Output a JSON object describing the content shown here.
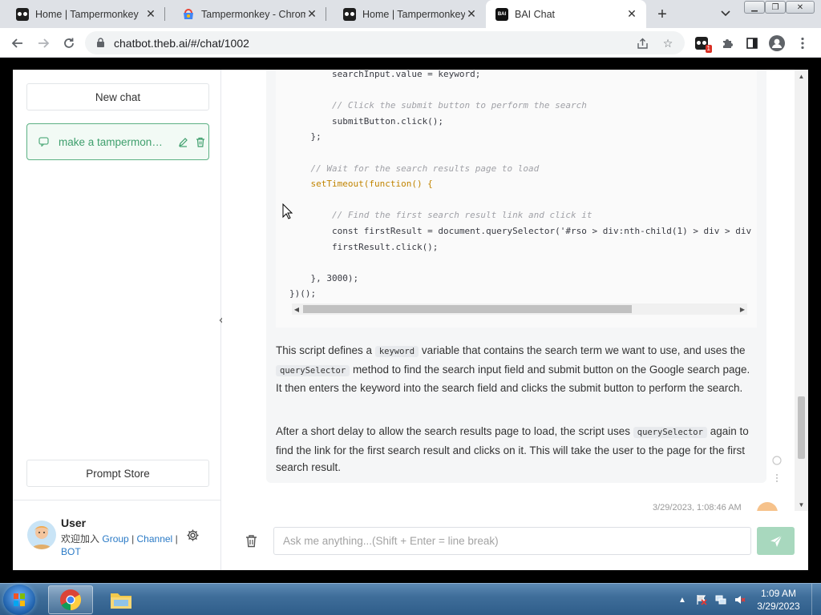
{
  "browser": {
    "tabs": [
      {
        "label": "Home | Tampermonkey",
        "icon": "tampermonkey-icon"
      },
      {
        "label": "Tampermonkey - Chrome",
        "icon": "chrome-webstore-icon"
      },
      {
        "label": "Home | Tampermonkey",
        "icon": "tampermonkey-icon"
      },
      {
        "label": "BAI Chat",
        "icon": "bai-icon",
        "active": true
      }
    ],
    "url": "chatbot.theb.ai/#/chat/1002",
    "extension_badge": "1"
  },
  "sidebar": {
    "new_chat_label": "New chat",
    "chats": [
      {
        "label": "make a tampermonkey script",
        "active": true
      }
    ],
    "prompt_store_label": "Prompt Store",
    "user": {
      "name": "User",
      "sub_prefix": "欢迎加入",
      "links": [
        "Group",
        "Channel",
        "BOT"
      ]
    }
  },
  "chat": {
    "code_lines": [
      "        searchInput.value = keyword;",
      "",
      "        // Click the submit button to perform the search",
      "        submitButton.click();",
      "    };",
      "",
      "    // Wait for the search results page to load",
      "    setTimeout(function() {",
      "",
      "        // Find the first search result link and click it",
      "        const firstResult = document.querySelector('#rso > div:nth-child(1) > div > div",
      "        firstResult.click();",
      "",
      "    }, 3000);",
      "})();"
    ],
    "para1": {
      "t1": "This script defines a ",
      "c1": "keyword",
      "t2": " variable that contains the search term we want to use, and uses the ",
      "c2": "querySelector",
      "t3": " method to find the search input field and submit button on the Google search page. It then enters the keyword into the search field and clicks the submit button to perform the search."
    },
    "para2": {
      "t1": "After a short delay to allow the search results page to load, the script uses ",
      "c1": "querySelector",
      "t2": " again to find the link for the first search result and clicks on it. This will take the user to the page for the first search result."
    },
    "timestamp": "3/29/2023, 1:08:46 AM",
    "input_placeholder": "Ask me anything...(Shift + Enter = line break)"
  },
  "taskbar": {
    "time": "1:09 AM",
    "date": "3/29/2023"
  },
  "colors": {
    "accent": "#3f9f6d",
    "send_button": "#a8d8be",
    "link": "#2a7ac6"
  }
}
